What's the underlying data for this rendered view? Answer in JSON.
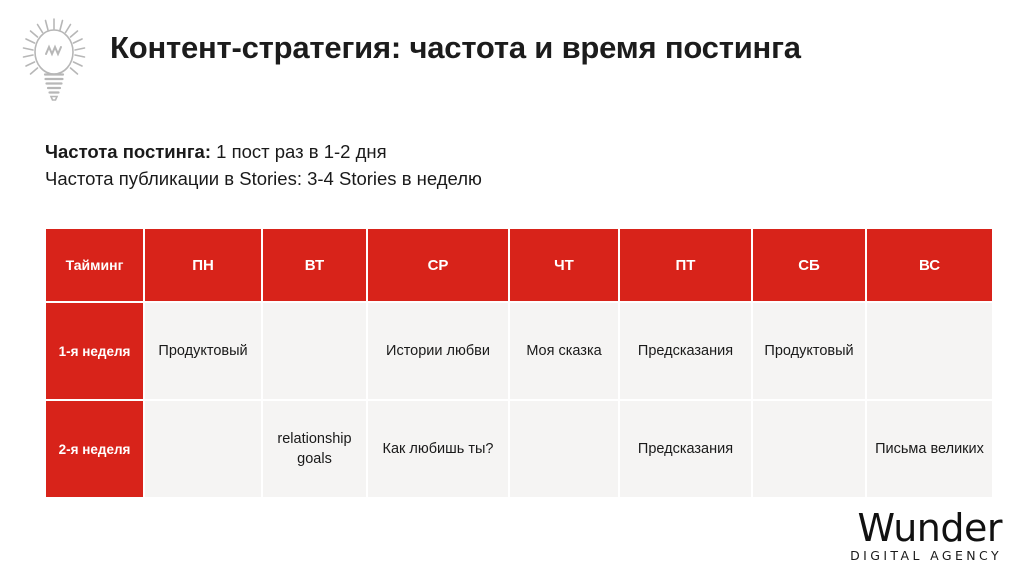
{
  "header": {
    "icon": "lightbulb-icon",
    "title": "Контент-стратегия: частота и время постинга"
  },
  "intro": {
    "line1_lead": "Частота постинга:",
    "line1_rest": " 1 пост раз в 1-2 дня",
    "line2": "Частота публикации в Stories: 3-4 Stories в неделю"
  },
  "table": {
    "columns": [
      "Тайминг",
      "ПН",
      "ВТ",
      "СР",
      "ЧТ",
      "ПТ",
      "СБ",
      "ВС"
    ],
    "rows": [
      {
        "label": "1-я неделя",
        "cells": [
          "Продуктовый",
          "",
          "Истории любви",
          "Моя сказка",
          "Предсказания",
          "Продуктовый",
          ""
        ]
      },
      {
        "label": "2-я неделя",
        "cells": [
          "",
          "relationship goals",
          "Как любишь ты?",
          "",
          "Предсказания",
          "",
          "Письма великих"
        ]
      }
    ]
  },
  "logo": {
    "word": "Wunder",
    "tagline": "DIGITAL AGENCY"
  },
  "colors": {
    "accent_red": "#D8231A",
    "cell_bg": "#F5F4F3",
    "text": "#1a1a1a",
    "icon_gray": "#b7b7b7"
  }
}
